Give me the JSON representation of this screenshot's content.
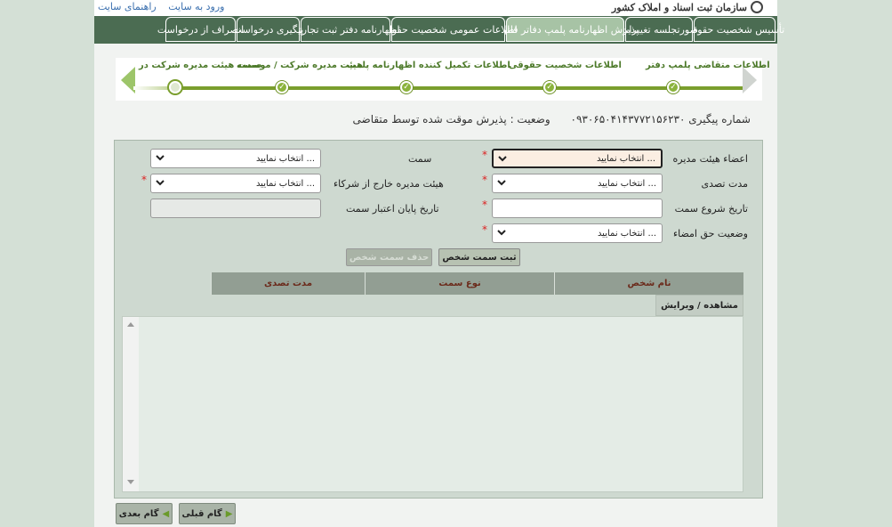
{
  "header": {
    "links": [
      "ورود به سایت",
      "راهنمای سایت"
    ],
    "logo_text": "سازمان ثبت اسناد و املاک کشور"
  },
  "tabs": [
    {
      "label": "تأسیس شخصیت حقوقی",
      "active": false
    },
    {
      "label": "صورتجلسه تغییرات",
      "active": false
    },
    {
      "label": "پذیرش اظهارنامه پلمپ دفاتر قانونی",
      "active": true
    },
    {
      "label": "اطلاعات عمومی شخصیت حقوقی",
      "active": false
    },
    {
      "label": "اظهارنامه دفتر ثبت تجارتی",
      "active": false
    },
    {
      "label": "پیگیری درخواست",
      "active": false
    },
    {
      "label": "انصراف از درخواست",
      "active": false
    }
  ],
  "wizard": {
    "steps": [
      "اطلاعات متقاضی پلمپ دفتر",
      "اطلاعات شخصیت حقوقی",
      "اطلاعات تکمیل کننده اظهارنامه پلمپ",
      "هیئت مدیره شرکت / موسسه",
      "سمت هیئت مدیره شرکت در"
    ],
    "current_index": 4
  },
  "tracking": {
    "number_text": "شماره پیگیری ۰۹۳۰۶۵۰۴۱۴۳۷۷۲۱۵۶۲۳۰",
    "status_text": "وضعیت : پذیرش موقت شده توسط متقاضی"
  },
  "form": {
    "board_members_label": "اعضاء هیئت مدیره",
    "board_members_value": "انتخاب نمایید ...",
    "position_label": "سمت",
    "position_value": "انتخاب نمایید ...",
    "term_label": "مدت تصدی",
    "term_value": "انتخاب نمایید ...",
    "external_board_label": "هیئت مدیره خارج از شرکاء",
    "external_board_value": "انتخاب نمایید ...",
    "start_date_label": "تاریخ شروع سمت",
    "end_date_label": "تاریخ پایان اعتبار سمت",
    "signature_label": "وضعیت حق امضاء",
    "signature_value": "انتخاب نمایید ...",
    "required_mark": "*"
  },
  "actions": {
    "register_label": "ثبت سمت شخص",
    "delete_label": "حذف سمت شخص"
  },
  "grid": {
    "columns": [
      "نام شخص",
      "نوع سمت",
      "مدت تصدی"
    ],
    "action_column": "مشاهده / ویرایش",
    "rows": []
  },
  "nav": {
    "prev_label": "گام قبلی",
    "next_label": "گام بعدی"
  },
  "colors": {
    "tab_bg": "#4b6c52",
    "tab_active_bg": "#a7c3a5",
    "wizard_green": "#7a9e2d",
    "panel_bg": "#ced9d0",
    "header_text": "#6b2a1b",
    "required": "#dd2222"
  }
}
